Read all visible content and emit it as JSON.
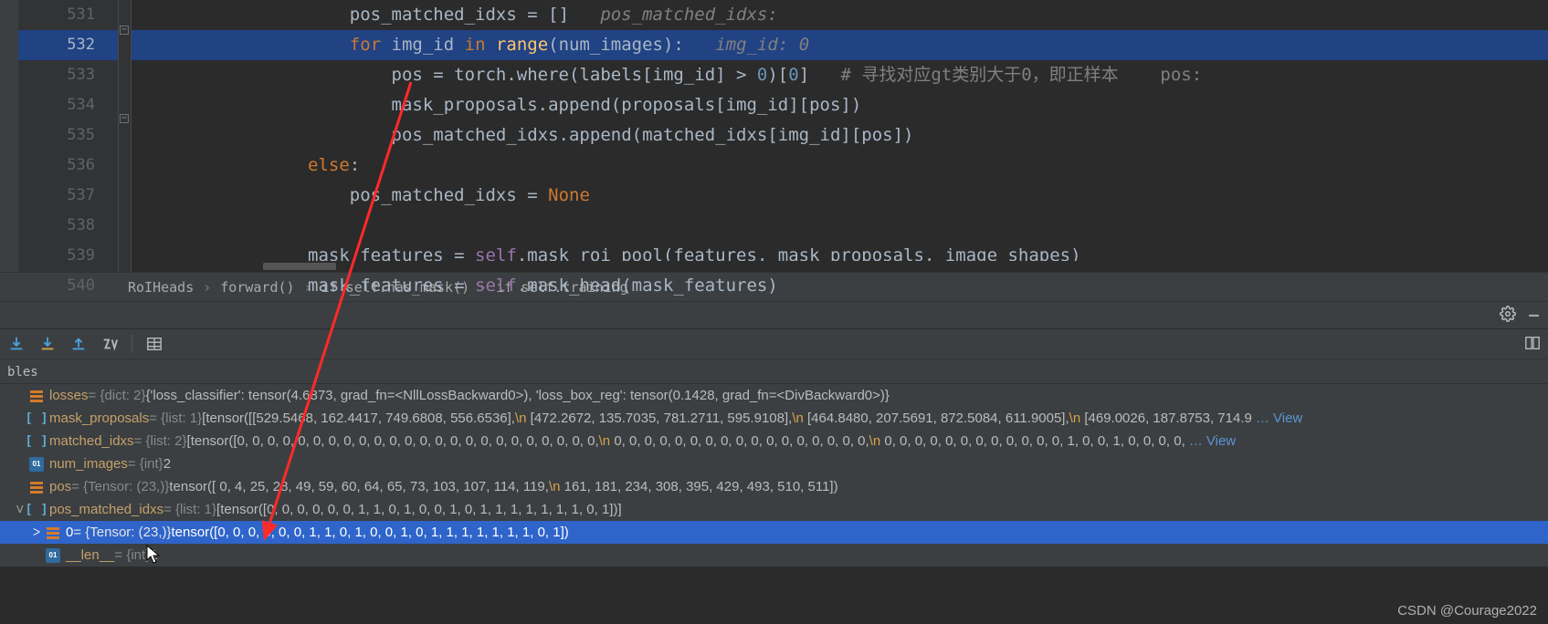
{
  "editor": {
    "lines_start": 531,
    "highlighted_line": 532,
    "code": {
      "l531": {
        "segments": [
          {
            "t": "                    pos_matched_idxs ",
            "c": ""
          },
          {
            "t": "= ",
            "c": ""
          },
          {
            "t": "[]   ",
            "c": ""
          },
          {
            "t": "pos_matched_idxs:",
            "c": "hint"
          }
        ]
      },
      "l532": {
        "segments": [
          {
            "t": "                    ",
            "c": ""
          },
          {
            "t": "for ",
            "c": "kw"
          },
          {
            "t": "img_id ",
            "c": ""
          },
          {
            "t": "in ",
            "c": "kw"
          },
          {
            "t": "range",
            "c": "fn"
          },
          {
            "t": "(num_images):",
            "c": ""
          },
          {
            "t": "   ",
            "c": ""
          },
          {
            "t": "img_id: 0",
            "c": "hint"
          }
        ]
      },
      "l533": {
        "segments": [
          {
            "t": "                        pos = torch.where(labels[img_id] > ",
            "c": ""
          },
          {
            "t": "0",
            "c": "num"
          },
          {
            "t": ")[",
            "c": ""
          },
          {
            "t": "0",
            "c": "num"
          },
          {
            "t": "]   ",
            "c": ""
          },
          {
            "t": "# 寻找对应gt类别大于0，即正样本    pos:",
            "c": "cmt"
          }
        ]
      },
      "l534": {
        "segments": [
          {
            "t": "                        mask_proposals.append(proposals[img_id][pos])",
            "c": ""
          }
        ]
      },
      "l535": {
        "segments": [
          {
            "t": "                        pos_matched_idxs.append(matched_idxs[img_id][pos])",
            "c": ""
          }
        ]
      },
      "l536": {
        "segments": [
          {
            "t": "                ",
            "c": ""
          },
          {
            "t": "else",
            "c": "kw"
          },
          {
            "t": ":",
            "c": ""
          }
        ]
      },
      "l537": {
        "segments": [
          {
            "t": "                    pos_matched_idxs = ",
            "c": ""
          },
          {
            "t": "None",
            "c": "kw"
          }
        ]
      },
      "l538": {
        "segments": [
          {
            "t": "",
            "c": ""
          }
        ]
      },
      "l539": {
        "segments": [
          {
            "t": "                mask_features = ",
            "c": ""
          },
          {
            "t": "self",
            "c": "self"
          },
          {
            "t": ".mask_roi_pool(features, mask_proposals, image_shapes)",
            "c": ""
          }
        ]
      },
      "l540": {
        "segments": [
          {
            "t": "                mask_features = ",
            "c": ""
          },
          {
            "t": "self",
            "c": "self"
          },
          {
            "t": ".mask_head(mask_features)",
            "c": ""
          }
        ]
      }
    }
  },
  "breadcrumb": {
    "items": [
      "RoIHeads",
      "forward()",
      "if self.has_mask()",
      "if self.training"
    ]
  },
  "debug": {
    "tab_label": "bles",
    "toolbar": {
      "step_into": "step-into",
      "step_into_my": "step-into-my",
      "step_out": "step-out",
      "evaluate": "evaluate",
      "watch": "view-as-table"
    },
    "settings_icon": "gear-icon",
    "minimize_icon": "minimize-icon",
    "layout_icon": "layout-icon"
  },
  "variables": [
    {
      "indent": 1,
      "expander": "",
      "icon": "list",
      "name": "losses",
      "type": " = {dict: 2} ",
      "value": "{'loss_classifier': tensor(4.6873, grad_fn=<NllLossBackward0>), 'loss_box_reg': tensor(0.1428, grad_fn=<DivBackward0>)}"
    },
    {
      "indent": 1,
      "expander": "",
      "icon": "seq",
      "name": "mask_proposals",
      "type": " = {list: 1} ",
      "value": "[tensor([[529.5468, 162.4417, 749.6808, 556.6536],\\n         [472.2672, 135.7035, 781.2711, 595.9108],\\n         [464.8480, 207.5691, 872.5084, 611.9005],\\n         [469.0026, 187.8753, 714.9",
      "view": "… View"
    },
    {
      "indent": 1,
      "expander": "",
      "icon": "seq",
      "name": "matched_idxs",
      "type": " = {list: 2} ",
      "value": "[tensor([0, 0, 0, 0, 0, 0, 0, 0, 0, 0, 0, 0, 0, 0, 0, 0, 0, 0, 0, 0, 0, 0, 0, 0,\\n        0, 0, 0, 0, 0, 0, 0, 0, 0, 0, 0, 0, 0, 0, 0, 0, 0,\\n        0, 0, 0, 0, 0, 0, 0, 0, 0, 0, 0, 0, 1, 0, 0, 1, 0, 0, 0, 0,",
      "view": "… View"
    },
    {
      "indent": 1,
      "expander": "",
      "icon": "int",
      "name": "num_images",
      "type": " = {int} ",
      "value": "2"
    },
    {
      "indent": 1,
      "expander": "",
      "icon": "list",
      "name": "pos",
      "type": " = {Tensor: (23,)} ",
      "value": "tensor([  0,   4,  25,  28,  49,  59,  60,  64,  65,  73, 103, 107, 114, 119,\\n        161, 181, 234, 308, 395, 429, 493, 510, 511])"
    },
    {
      "indent": 1,
      "expander": "ᐯ",
      "icon": "seq",
      "name": "pos_matched_idxs",
      "type": " = {list: 1} ",
      "value": "[tensor([0, 0, 0, 0, 0, 0, 1, 1, 0, 1, 0, 0, 1, 0, 1, 1, 1, 1, 1, 1, 1, 0, 1])]"
    },
    {
      "indent": 2,
      "expander": "ᐳ",
      "icon": "list",
      "name": "0",
      "type": " = {Tensor: (23,)} ",
      "value": "tensor([0, 0, 0, 0, 0, 0, 1, 1, 0, 1, 0, 0, 1, 0, 1, 1, 1, 1, 1, 1, 1, 0, 1])",
      "selected": true
    },
    {
      "indent": 2,
      "expander": "",
      "icon": "int",
      "name": "__len__",
      "type": " = {int} ",
      "value": "1"
    }
  ],
  "watermark": "CSDN @Courage2022"
}
